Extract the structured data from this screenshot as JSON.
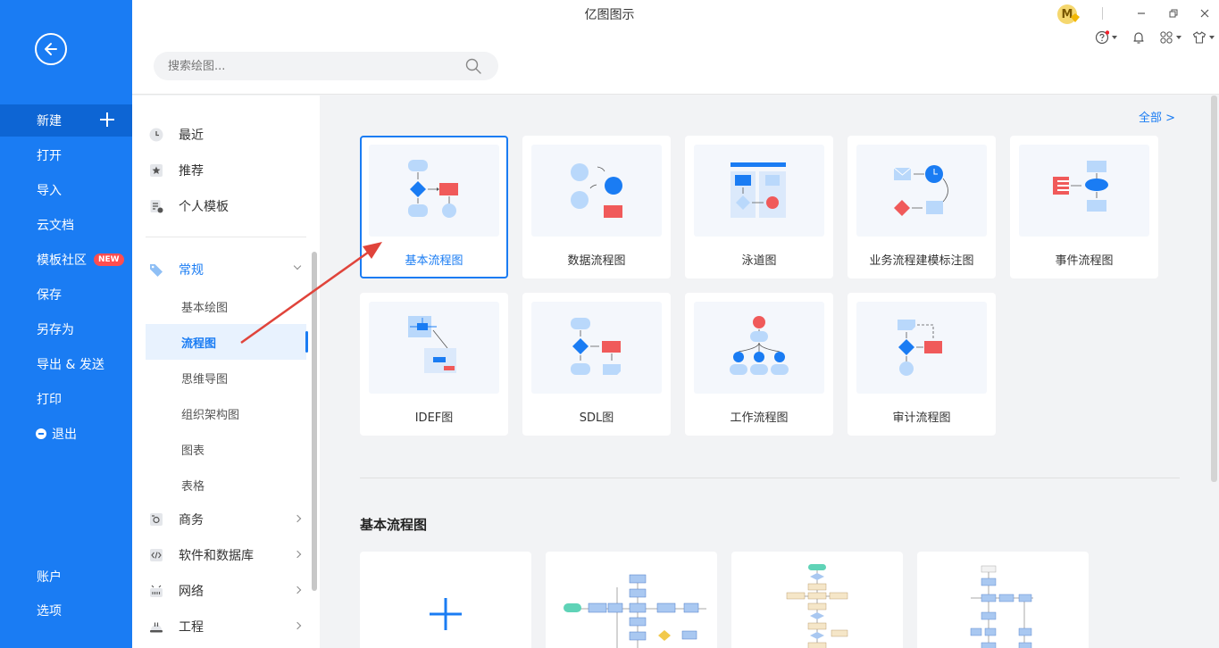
{
  "window": {
    "title": "亿图图示"
  },
  "sidebar": {
    "items": [
      {
        "label": "新建"
      },
      {
        "label": "打开"
      },
      {
        "label": "导入"
      },
      {
        "label": "云文档"
      },
      {
        "label": "模板社区",
        "badge": "NEW"
      },
      {
        "label": "保存"
      },
      {
        "label": "另存为"
      },
      {
        "label": "导出 & 发送"
      },
      {
        "label": "打印"
      },
      {
        "label": "退出"
      }
    ],
    "bottom": [
      {
        "label": "账户"
      },
      {
        "label": "选项"
      }
    ]
  },
  "search": {
    "placeholder": "搜索绘图..."
  },
  "user": {
    "avatar_letter": "M"
  },
  "categories": {
    "top": [
      {
        "label": "最近",
        "icon": "clock-icon"
      },
      {
        "label": "推荐",
        "icon": "star-icon"
      },
      {
        "label": "个人模板",
        "icon": "template-icon"
      }
    ],
    "group": {
      "label": "常规",
      "icon": "tag-icon"
    },
    "sub": [
      {
        "label": "基本绘图"
      },
      {
        "label": "流程图"
      },
      {
        "label": "思维导图"
      },
      {
        "label": "组织架构图"
      },
      {
        "label": "图表"
      },
      {
        "label": "表格"
      }
    ],
    "more": [
      {
        "label": "商务",
        "icon": "briefcase-icon"
      },
      {
        "label": "软件和数据库",
        "icon": "code-icon"
      },
      {
        "label": "网络",
        "icon": "network-icon"
      },
      {
        "label": "工程",
        "icon": "helmet-icon"
      }
    ]
  },
  "main": {
    "all_link": "全部  >",
    "types": [
      {
        "label": "基本流程图"
      },
      {
        "label": "数据流程图"
      },
      {
        "label": "泳道图"
      },
      {
        "label": "业务流程建模标注图"
      },
      {
        "label": "事件流程图"
      },
      {
        "label": "IDEF图"
      },
      {
        "label": "SDL图"
      },
      {
        "label": "工作流程图"
      },
      {
        "label": "审计流程图"
      }
    ],
    "section_title": "基本流程图"
  },
  "colors": {
    "brand": "#1a7cf3",
    "accent_red": "#f05a5a",
    "shape_light": "#b9d8fb",
    "shape_blue": "#1a7cf3"
  }
}
